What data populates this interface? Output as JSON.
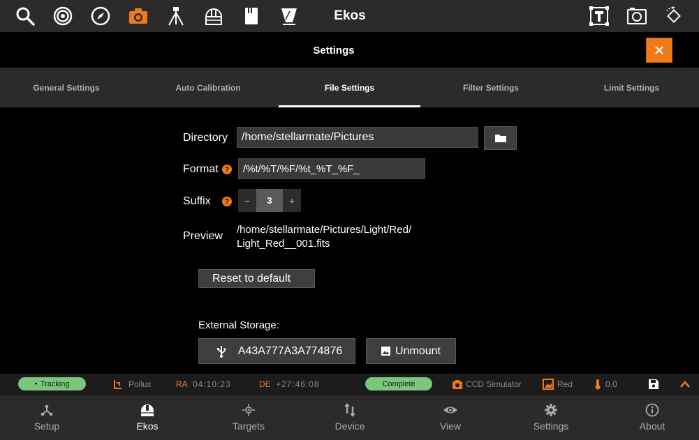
{
  "app": {
    "title": "Ekos"
  },
  "toolbar": {
    "icons": [
      "search-icon",
      "target-icon",
      "compass-icon",
      "camera-icon",
      "tripod-icon",
      "dome-icon",
      "filter-holder-icon",
      "flat-panel-icon",
      "text-frame-icon",
      "frame-camera-icon",
      "rotate-icon"
    ],
    "accent": "#f07a1a"
  },
  "settings": {
    "title": "Settings",
    "tabs": [
      {
        "label": "General Settings",
        "active": false
      },
      {
        "label": "Auto Calibration",
        "active": false
      },
      {
        "label": "File Settings",
        "active": true
      },
      {
        "label": "Filter Settings",
        "active": false
      },
      {
        "label": "Limit Settings",
        "active": false
      }
    ]
  },
  "file_settings": {
    "directory_label": "Directory",
    "directory_value": "/home/stellarmate/Pictures",
    "format_label": "Format",
    "format_value": "/%t/%T/%F/%t_%T_%F_",
    "suffix_label": "Suffix",
    "suffix_value": "3",
    "suffix_minus": "−",
    "suffix_plus": "+",
    "preview_label": "Preview",
    "preview_line1": "/home/stellarmate/Pictures/Light/Red/",
    "preview_line2": "Light_Red__001.fits",
    "help_glyph": "?",
    "reset_label": "Reset to default",
    "external_storage_label": "External Storage:",
    "storage_device": "A43A777A3A774876",
    "unmount_label": "Unmount"
  },
  "statusbar": {
    "tracking": "Tracking",
    "target": "Pollux",
    "ra_label": "RA",
    "ra_value": "04:10:23",
    "de_label": "DE",
    "de_value": "+27:46:08",
    "capture_status": "Complete",
    "camera": "CCD Simulator",
    "filter": "Red",
    "temperature": "0.0",
    "status_color": "#7bc57c"
  },
  "bottomnav": {
    "items": [
      {
        "label": "Setup",
        "icon": "setup-icon",
        "active": false
      },
      {
        "label": "Ekos",
        "icon": "ekos-dome-icon",
        "active": true
      },
      {
        "label": "Targets",
        "icon": "targets-icon",
        "active": false
      },
      {
        "label": "Device",
        "icon": "device-icon",
        "active": false
      },
      {
        "label": "View",
        "icon": "eye-icon",
        "active": false
      },
      {
        "label": "Settings",
        "icon": "gear-icon",
        "active": false
      },
      {
        "label": "About",
        "icon": "info-icon",
        "active": false
      }
    ]
  }
}
